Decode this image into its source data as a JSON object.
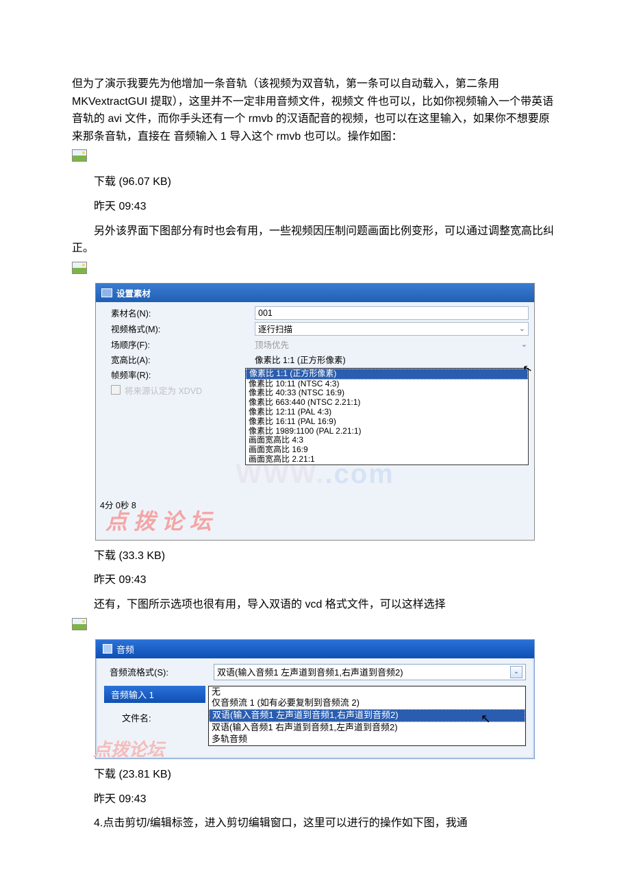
{
  "paragraphs": {
    "p1": "但为了演示我要先为他增加一条音轨（该视频为双音轨，第一条可以自动载入，第二条用 MKVextractGUI 提取），这里并不一定非用音频文件，视频文 件也可以，比如你视频输入一个带英语音轨的 avi 文件，而你手头还有一个 rmvb 的汉语配音的视频，也可以在这里输入，如果你不想要原来那条音轨，直接在 音频输入 1 导入这个 rmvb 也可以。操作如图：",
    "dl1": "下载 (96.07 KB)",
    "t1": "昨天 09:43",
    "p2": "另外该界面下图部分有时也会有用，一些视频因压制问题画面比例变形，可以通过调整宽高比纠正。",
    "dl2": "下载 (33.3 KB)",
    "t2": "昨天 09:43",
    "p3": "还有，下图所示选项也很有用，导入双语的 vcd 格式文件，可以这样选择",
    "dl3": "下载 (23.81 KB)",
    "t3": "昨天 09:43",
    "p4": "4.点击剪切/编辑标签，进入剪切编辑窗口，这里可以进行的操作如下图，我通"
  },
  "shot1": {
    "title": "设置素材",
    "rows": {
      "name_label": "素材名(N):",
      "name_value": "001",
      "video_fmt_label": "视频格式(M):",
      "video_fmt_value": "逐行扫描",
      "field_order_label": "场顺序(F):",
      "field_order_value": "顶场优先",
      "aspect_label": "宽高比(A):",
      "aspect_value": "像素比 1:1 (正方形像素)",
      "fps_label": "帧频率(R):",
      "checkbox_label": "将来源认定为 XDVD"
    },
    "aspect_options": [
      "像素比 1:1 (正方形像素)",
      "像素比 10:11 (NTSC 4:3)",
      "像素比 40:33 (NTSC 16:9)",
      "像素比 663:440 (NTSC 2.21:1)",
      "像素比 12:11 (PAL 4:3)",
      "像素比 16:11 (PAL 16:9)",
      "像素比 1989:1100 (PAL 2.21:1)",
      "画面宽高比 4:3",
      "画面宽高比 16:9",
      "画面宽高比 2.21:1"
    ],
    "bottom": "4分 0秒 8",
    "wm1": "WWW.",
    "wm_suffix": ".com",
    "wm2": "点 拨 论 坛"
  },
  "shot2": {
    "title": "音频",
    "stream_label": "音频流格式(S):",
    "stream_value": "双语(输入音频1 左声道到音频1,右声道到音频2)",
    "input_label": "音频输入 1",
    "file_label": "文件名:",
    "options": [
      "无",
      "仅音频流 1 (如有必要复制到音频流 2)",
      "双语(输入音频1 左声道到音频1,右声道到音频2)",
      "双语(输入音频1 右声道到音频1,左声道到音频2)",
      "多轨音频"
    ],
    "wm": "点拨论坛"
  }
}
